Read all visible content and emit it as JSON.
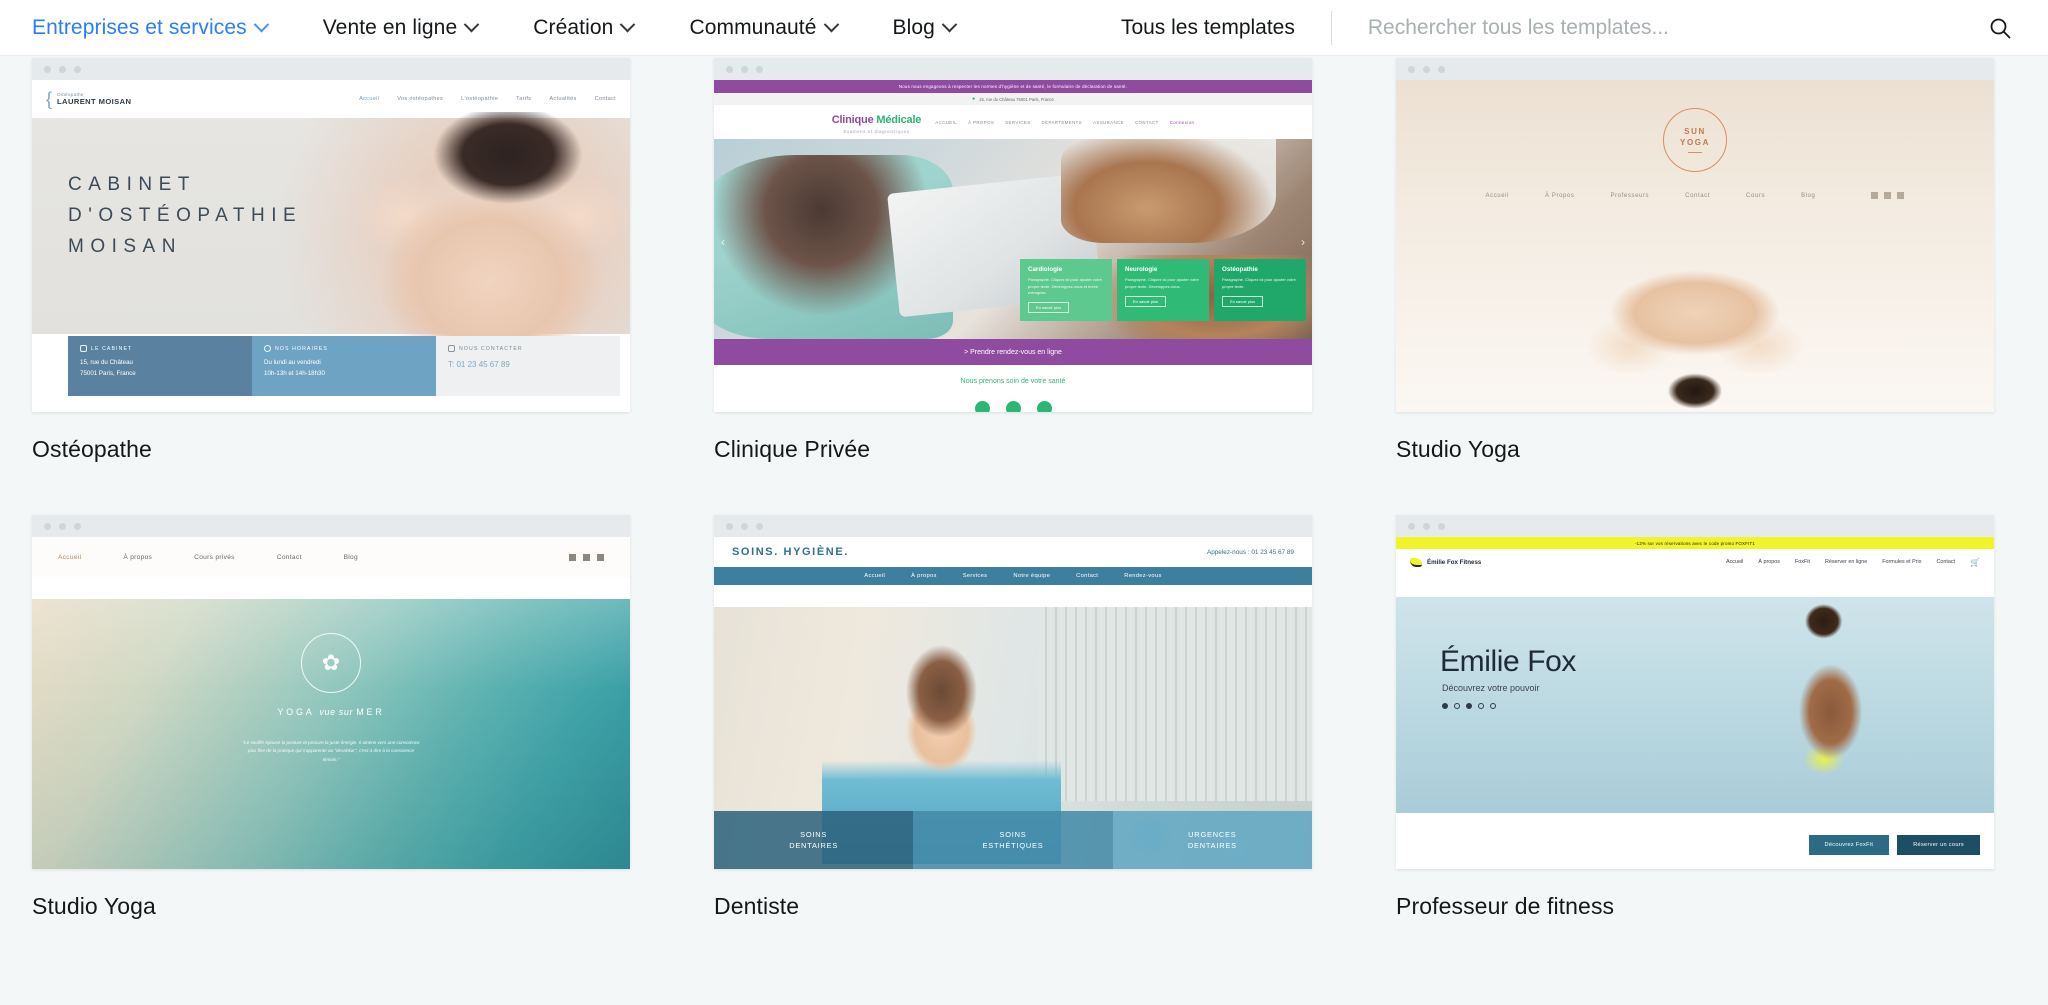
{
  "nav": {
    "items": [
      {
        "label": "Entreprises et services",
        "caret": true,
        "active": true
      },
      {
        "label": "Vente en ligne",
        "caret": true,
        "active": false
      },
      {
        "label": "Création",
        "caret": true,
        "active": false
      },
      {
        "label": "Communauté",
        "caret": true,
        "active": false
      },
      {
        "label": "Blog",
        "caret": true,
        "active": false
      }
    ],
    "all_templates": "Tous les templates",
    "search_placeholder": "Rechercher tous les templates...",
    "search_value": "",
    "search_icon": "search-icon",
    "accent_color": "#2b7cff"
  },
  "cards": [
    {
      "title": "Ostéopathe",
      "preview": {
        "logo_small": "Ostéopathe",
        "logo_name": "LAURENT MOISAN",
        "nav": [
          "Accueil",
          "Vos ostéopathes",
          "L'ostéopathie",
          "Tarifs",
          "Actualités",
          "Contact"
        ],
        "headline": "CABINET\nD'OSTÉOPATHIE\nMOISAN",
        "boxes": [
          {
            "title": "LE CABINET",
            "icon": "home-icon",
            "lines": [
              "15, rue du Château",
              "75001 Paris, France"
            ]
          },
          {
            "title": "NOS HORAIRES",
            "icon": "clock-icon",
            "lines": [
              "Du lundi au vendredi",
              "10h-13h et 14h-18h30"
            ]
          },
          {
            "title": "NOUS CONTACTER",
            "icon": "mail-icon",
            "lines": [
              "T: 01 23 45 67 89"
            ]
          }
        ]
      }
    },
    {
      "title": "Clinique Privée",
      "preview": {
        "banner": "Nous nous engageons à respecter les normes d'hygiène et de santé, le formulaire de déclaration de santé.",
        "address": "15, rue du Château 75001 Paris, France",
        "brand_a": "Clinique ",
        "brand_b": "Médicale",
        "brand_sub": "Examens et diagnostiques",
        "nav": [
          "ACCUEIL",
          "À PROPOS",
          "SERVICES",
          "DÉPARTEMENTS",
          "ASSURANCE",
          "CONTACT",
          "Connexion"
        ],
        "service_cards": [
          {
            "title": "Cardiologie",
            "body": "Paragraphe. Cliquez ici pour ajouter votre propre texte. Développez-vous et écrire extragrise.",
            "button": "En savoir plus"
          },
          {
            "title": "Neurologie",
            "body": "Paragraphe. Cliquez ici pour ajouter votre propre texte. Développez-vous.",
            "button": "En savoir plus"
          },
          {
            "title": "Ostéopathie",
            "body": "Paragraphe. Cliquez ici pour ajouter votre propre texte.",
            "button": "En savoir plus"
          }
        ],
        "cta": "> Prendre rendez-vous en ligne",
        "tagline": "Nous prenons soin de votre santé"
      }
    },
    {
      "title": "Studio Yoga",
      "preview": {
        "logo_line1": "SUN",
        "logo_line2": "YOGA",
        "nav": [
          "Accueil",
          "À Propos",
          "Professeurs",
          "Contact",
          "Cours",
          "Blog"
        ],
        "socials": [
          "facebook-icon",
          "instagram-icon",
          "twitter-icon"
        ]
      }
    },
    {
      "title": "Studio Yoga",
      "preview": {
        "nav": [
          "Accueil",
          "À propos",
          "Cours privés",
          "Contact",
          "Blog"
        ],
        "socials": [
          "facebook-icon",
          "instagram-icon",
          "twitter-icon"
        ],
        "logo": "lotus-icon",
        "title_a": "YOGA ",
        "title_b": "vue sur ",
        "title_c": "MER",
        "quote": "\"Le souffle épouse la posture et procure la juste énergie. Il amène vers une conscience plus fine de la pratique qui s'apparente au \"desahkar\", c'est à dire à la conscience témoin.\""
      }
    },
    {
      "title": "Dentiste",
      "preview": {
        "brand": "SOINS. HYGIÈNE.",
        "phone": "Appelez-nous : 01 23 45 67 89",
        "nav": [
          "Accueil",
          "À propos",
          "Services",
          "Notre équipe",
          "Contact",
          "Rendez-vous"
        ],
        "tiles": [
          "SOINS\nDENTAIRES",
          "SOINS\nESTHÉTIQUES",
          "URGENCES\nDENTAIRES"
        ]
      }
    },
    {
      "title": "Professeur de fitness",
      "preview": {
        "promo": "-12% sur vos réservations avec le code promo FOXFIT1",
        "logo": "Émilie Fox Fitness",
        "nav": [
          "Accueil",
          "À propos",
          "FoxFit",
          "Réserver en ligne",
          "Formules et Prix",
          "Contact"
        ],
        "cart_icon": "cart-icon",
        "headline": "Émilie Fox",
        "subhead": "Découvrez votre pouvoir",
        "dots": 5,
        "buttons": [
          "Découvrez FoxFit",
          "Réserver un cours"
        ]
      }
    }
  ]
}
